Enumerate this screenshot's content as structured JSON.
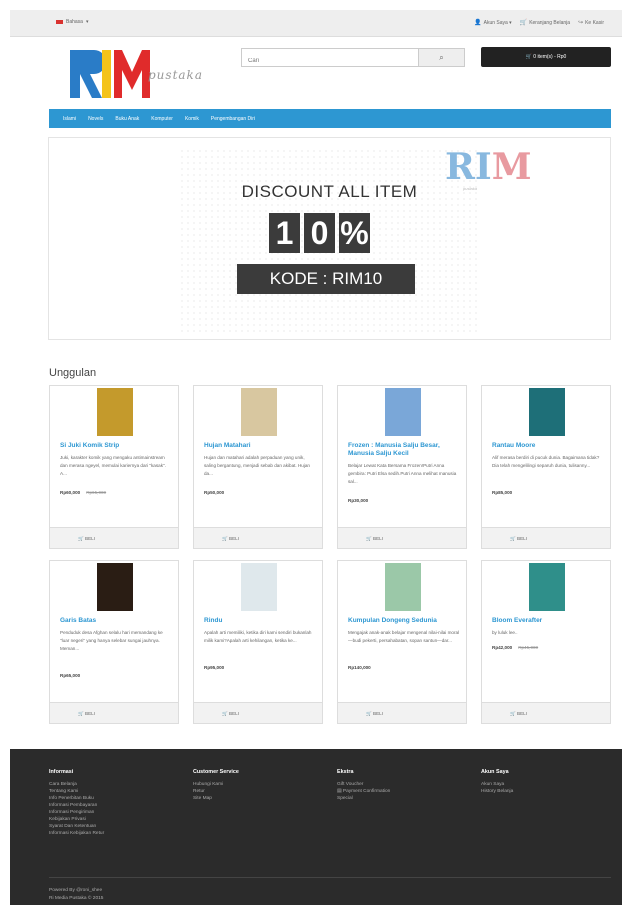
{
  "topbar": {
    "language": "Bahasa",
    "links": [
      "Akun Saya",
      "Keranjang Belanja",
      "Ke Kasir"
    ]
  },
  "brand": {
    "wordmark": "RIM",
    "tagline": "pustaka"
  },
  "search": {
    "placeholder": "Cari"
  },
  "cart": {
    "label": "0 item(s) - Rp0"
  },
  "nav": {
    "items": [
      "Islami",
      "Novels",
      "Buku Anak",
      "Komputer",
      "Komik",
      "Pengembangan Diri"
    ]
  },
  "banner": {
    "headline": "DISCOUNT ALL ITEM",
    "digits": [
      "1",
      "0",
      "%"
    ],
    "code": "KODE : RIM10",
    "mini_logo_a": "RI",
    "mini_logo_b": "M",
    "mini_logo_sub": "pustaka"
  },
  "featured": {
    "title": "Unggulan",
    "buy_label": "BELI",
    "products": [
      {
        "title": "Si Juki Komik Strip",
        "desc": "Juki, karakter komik yang mengaku antimainstream dan merasa ngeyel, memulai kariernya dari \"kasak\". A...",
        "price": "Rp60,000",
        "old_price": "Rp65,000",
        "cover_color": "#c49a2c"
      },
      {
        "title": "Hujan Matahari",
        "desc": "Hujan dan matahari adalah perpaduan yang unik, saling bergantung, menjadi sebab dan akibat. Hujan da...",
        "price": "Rp50,000",
        "old_price": "",
        "cover_color": "#d8c7a0"
      },
      {
        "title": "Frozen : Manusia Salju Besar, Manusia Salju Kecil",
        "desc": "Belajar Lewat Kata Bersama Frozen!Putri Anna gembira: Putri Elsa sedih.Putri Anna melihat manusia sal...",
        "price": "Rp30,000",
        "old_price": "",
        "cover_color": "#7aa7d8"
      },
      {
        "title": "Rantau Moore",
        "desc": "Alif merasa berdiri di pucuk dunia. Bagaimana tidak? Dia telah mengelilingi separuh dunia, tulisanny...",
        "price": "Rp85,000",
        "old_price": "",
        "cover_color": "#1e6f78"
      },
      {
        "title": "Garis Batas",
        "desc": "Penduduk desa Afghan selalu hari memandang ke \"luar negeri\" yang hanya selebar sungai jauhnya. Meman...",
        "price": "Rp65,000",
        "old_price": "",
        "cover_color": "#2a1d14"
      },
      {
        "title": "Rindu",
        "desc": "Apalah arti memiliki, ketika diri kami sendiri bukanlah milik kami?Apalah arti kehilangan, ketika ke...",
        "price": "Rp95,000",
        "old_price": "",
        "cover_color": "#dfe8ec"
      },
      {
        "title": "Kumpulan Dongeng Sedunia",
        "desc": "Mengajak anak-anak belajar mengenal nilai-nilai moral—budi pekerti, persahabatan, sopan santun—dar...",
        "price": "Rp140,000",
        "old_price": "",
        "cover_color": "#9bc8a8"
      },
      {
        "title": "Bloom Everafter",
        "desc": "by luluk lee..",
        "price": "Rp42,000",
        "old_price": "Rp45,000",
        "cover_color": "#2f8f8a"
      }
    ]
  },
  "footer": {
    "columns": [
      {
        "heading": "Informasi",
        "links": [
          "Cara Belanja",
          "Tentang Kami",
          "Info Penerbitan Buku",
          "Informasi Pembayaran",
          "Informasi Pengiriman",
          "Kebijakan Privasi",
          "Syarat Dan Ketentuan",
          "Informasi Kebijakan Retur"
        ]
      },
      {
        "heading": "Customer Service",
        "links": [
          "Hubungi Kami",
          "Retur",
          "Site Map"
        ]
      },
      {
        "heading": "Ekstra",
        "links": [
          "Gift Voucher",
          "Payment Confirmation",
          "Special"
        ]
      },
      {
        "heading": "Akun Saya",
        "links": [
          "Akun Saya",
          "History Belanja"
        ]
      }
    ],
    "powered": "Powered By @roni_shee",
    "copyright": "Ri Media Pustaka © 2015"
  },
  "colors": {
    "accent": "#2d97d2",
    "footer_bg": "#2b2b2b",
    "logo_blue": "#2a7cc7",
    "logo_yellow": "#f4c31a",
    "logo_red": "#e02b2b"
  }
}
